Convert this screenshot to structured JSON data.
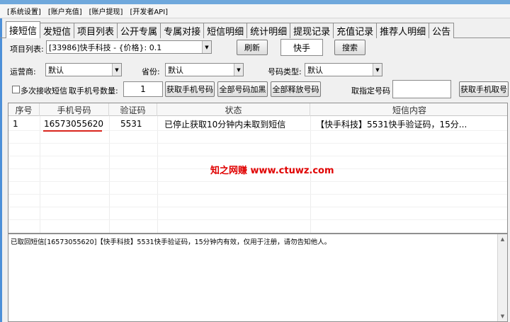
{
  "menu": [
    "[系统设置]",
    "[账户充值]",
    "[账户提现]",
    "[开发者API]"
  ],
  "tabs": [
    "接短信",
    "发短信",
    "项目列表",
    "公开专属",
    "专属对接",
    "短信明细",
    "统计明细",
    "提现记录",
    "充值记录",
    "推荐人明细",
    "公告"
  ],
  "project": {
    "label": "项目列表:",
    "value": "[33986]快手科技 - {价格}: 0.1",
    "refresh": "刷新",
    "search_value": "快手",
    "search_btn": "搜索"
  },
  "filters": {
    "carrier_label": "运营商:",
    "carrier_value": "默认",
    "province_label": "省份:",
    "province_value": "默认",
    "type_label": "号码类型:",
    "type_value": "默认"
  },
  "actions": {
    "multi_label": "多次接收短信",
    "count_label": "取手机号数量:",
    "count_value": "1",
    "get_btn": "获取手机号码",
    "block_all": "全部号码加黑",
    "release_all": "全部释放号码",
    "specific_label": "取指定号码",
    "specific_value": "",
    "get_btn2": "获取手机取号"
  },
  "table": {
    "headers": [
      "序号",
      "手机号码",
      "验证码",
      "状态",
      "短信内容"
    ],
    "rows": [
      [
        "1",
        "16573055620",
        "5531",
        "已停止获取10分钟内未取到短信",
        "【快手科技】5531快手验证码，15分..."
      ]
    ]
  },
  "watermark": "知之网赚 www.ctuwz.com",
  "log": "已取回短信[16573055620]【快手科技】5531快手验证码，15分钟内有效，仅用于注册，请勿告知他人。",
  "colors": {
    "accent": "#6fa8dc",
    "underline": "#d9251d",
    "watermark": "#e00000"
  }
}
